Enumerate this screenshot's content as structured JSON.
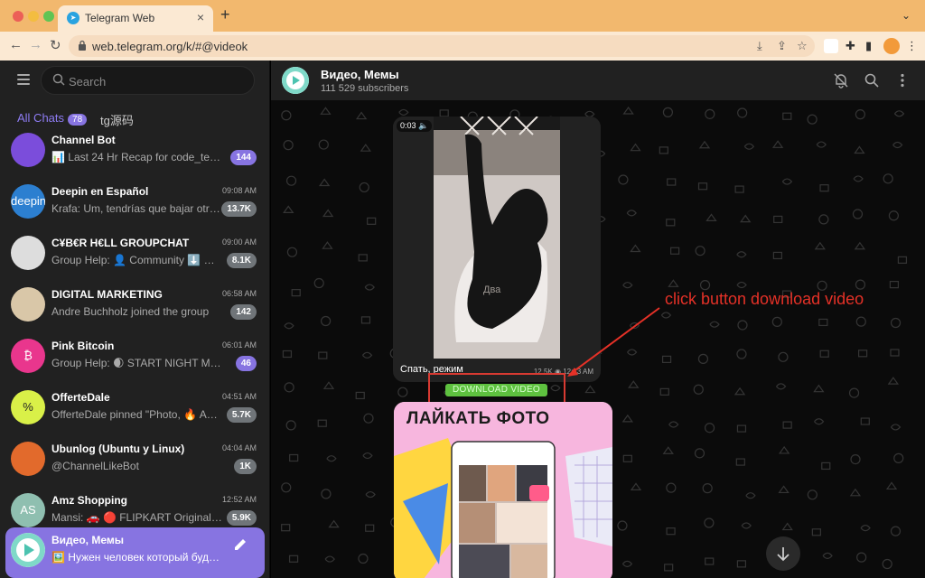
{
  "browser": {
    "tab_title": "Telegram Web",
    "url": "web.telegram.org/k/#@videok"
  },
  "sidebar": {
    "search_placeholder": "Search",
    "folders": [
      {
        "label": "All Chats",
        "badge": "78"
      },
      {
        "label": "tg源码"
      }
    ],
    "chats": [
      {
        "name": "Channel Bot",
        "time": "",
        "preview": "📊 Last 24 Hr Recap for code_test To...",
        "badge": "144",
        "muted": false,
        "avatar_color": "#7b4ddb",
        "avatar_text": ""
      },
      {
        "name": "Deepin en Español",
        "time": "09:08 AM",
        "preview": "Krafa: Um, tendrías que bajar otra v...",
        "badge": "13.7K",
        "muted": true,
        "avatar_color": "#2c7fd0",
        "avatar_text": "deepin"
      },
      {
        "name": "C¥B€R H€LL GROUPCHAT",
        "time": "09:00 AM",
        "preview": "Group Help: 👤 Community ⬇️ @cy...",
        "badge": "8.1K",
        "muted": true,
        "avatar_color": "#dddddd",
        "avatar_text": ""
      },
      {
        "name": "DIGITAL MARKETING",
        "time": "06:58 AM",
        "preview": "Andre Buchholz joined the group",
        "badge": "142",
        "muted": true,
        "avatar_color": "#d9c7a8",
        "avatar_text": ""
      },
      {
        "name": "Pink Bitcoin",
        "time": "06:01 AM",
        "preview": "Group Help: 🌒 START NIGHT MODE ...",
        "badge": "46",
        "muted": false,
        "avatar_color": "#e9368d",
        "avatar_text": "₿"
      },
      {
        "name": "OfferteDale",
        "time": "04:51 AM",
        "preview": "OfferteDale pinned \"Photo, 🔥 ARRIV...",
        "badge": "5.7K",
        "muted": true,
        "avatar_color": "#d9f048",
        "avatar_text": "%"
      },
      {
        "name": "Ubunlog (Ubuntu y Linux)",
        "time": "04:04 AM",
        "preview": "@ChannelLikeBot",
        "badge": "1K",
        "muted": true,
        "avatar_color": "#e26a2c",
        "avatar_text": ""
      },
      {
        "name": "Amz Shopping",
        "time": "12:52 AM",
        "preview": "Mansi: 🚗 🔴 FLIPKART Original Deal...",
        "badge": "5.9K",
        "muted": true,
        "avatar_color": "#8fbfb0",
        "avatar_text": "AS"
      },
      {
        "name": "Видео, Мемы",
        "time": "",
        "preview": "🖼️ Нужен человек который будет лайк...",
        "badge": "",
        "muted": false,
        "active": true,
        "avatar_color": "#ffffff",
        "avatar_text": ""
      }
    ]
  },
  "channel": {
    "title": "Видео, Мемы",
    "subscribers": "111 529 subscribers"
  },
  "messages": {
    "video": {
      "duration": "0:03",
      "caption": "Спать, режим",
      "views": "12.5K",
      "time": "12:13 AM",
      "watermark": "Два"
    },
    "download_label": "DOWNLOAD VIDEO",
    "image_title": "ЛАЙКАТЬ ФОТО"
  },
  "annotation": {
    "text": "click button download video",
    "color": "#e53127"
  },
  "colors": {
    "accent": "#8774e1",
    "download_button": "#5ec13f",
    "tabbar": "#f2b86e"
  }
}
